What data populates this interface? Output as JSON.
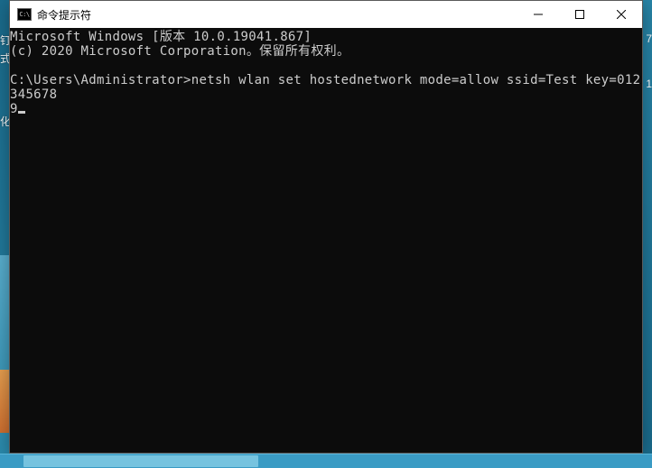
{
  "window": {
    "title": "命令提示符",
    "icon_label": "C:\\"
  },
  "terminal": {
    "line1": "Microsoft Windows [版本 10.0.19041.867]",
    "line2": "(c) 2020 Microsoft Corporation。保留所有权利。",
    "prompt": "C:\\Users\\Administrator>",
    "command": "netsh wlan set hostednetwork mode=allow ssid=Test key=012345678",
    "command_wrap": "9"
  },
  "artifacts": {
    "a1": "钉",
    "a2": "式",
    "a3": "",
    "a4": "化",
    "r1": "1",
    "r2": "7"
  }
}
